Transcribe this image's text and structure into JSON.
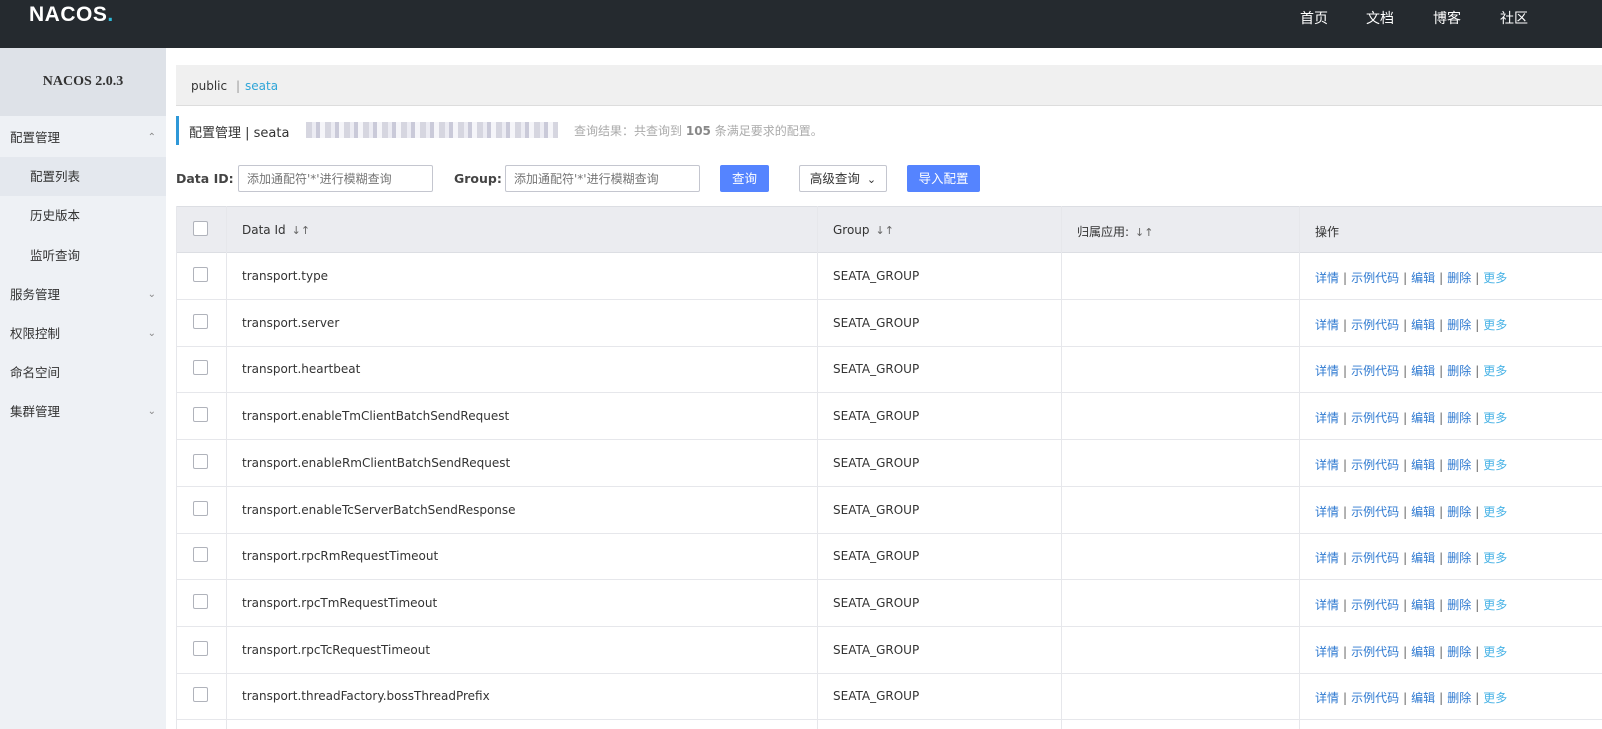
{
  "topbar": {
    "logo_text": "NACOS",
    "nav": [
      "首页",
      "文档",
      "博客",
      "社区"
    ]
  },
  "sidebar": {
    "title": "NACOS 2.0.3",
    "items": [
      {
        "label": "配置管理",
        "chevron": "up"
      },
      {
        "label": "配置列表",
        "sub": true,
        "active": true
      },
      {
        "label": "历史版本",
        "sub": true
      },
      {
        "label": "监听查询",
        "sub": true
      },
      {
        "label": "服务管理",
        "chevron": "down"
      },
      {
        "label": "权限控制",
        "chevron": "down"
      },
      {
        "label": "命名空间"
      },
      {
        "label": "集群管理",
        "chevron": "down"
      }
    ]
  },
  "namespaces": {
    "public": "public",
    "separator": "|",
    "seata": "seata"
  },
  "page": {
    "title": "配置管理 | seata",
    "query_prefix": "查询结果：共查询到",
    "query_count": "105",
    "query_suffix": "条满足要求的配置。"
  },
  "filters": {
    "dataid_label": "Data ID:",
    "dataid_placeholder": "添加通配符'*'进行模糊查询",
    "group_label": "Group:",
    "group_placeholder": "添加通配符'*'进行模糊查询",
    "query_button": "查询",
    "advanced_button": "高级查询",
    "import_button": "导入配置"
  },
  "table": {
    "headers": {
      "dataid": "Data Id",
      "group": "Group",
      "app": "归属应用:",
      "ops": "操作"
    },
    "ops": {
      "detail": "详情",
      "sample": "示例代码",
      "edit": "编辑",
      "delete": "删除",
      "more": "更多",
      "sep": "|"
    },
    "rows": [
      {
        "dataid": "transport.type",
        "group": "SEATA_GROUP",
        "app": ""
      },
      {
        "dataid": "transport.server",
        "group": "SEATA_GROUP",
        "app": ""
      },
      {
        "dataid": "transport.heartbeat",
        "group": "SEATA_GROUP",
        "app": ""
      },
      {
        "dataid": "transport.enableTmClientBatchSendRequest",
        "group": "SEATA_GROUP",
        "app": ""
      },
      {
        "dataid": "transport.enableRmClientBatchSendRequest",
        "group": "SEATA_GROUP",
        "app": ""
      },
      {
        "dataid": "transport.enableTcServerBatchSendResponse",
        "group": "SEATA_GROUP",
        "app": ""
      },
      {
        "dataid": "transport.rpcRmRequestTimeout",
        "group": "SEATA_GROUP",
        "app": ""
      },
      {
        "dataid": "transport.rpcTmRequestTimeout",
        "group": "SEATA_GROUP",
        "app": ""
      },
      {
        "dataid": "transport.rpcTcRequestTimeout",
        "group": "SEATA_GROUP",
        "app": ""
      },
      {
        "dataid": "transport.threadFactory.bossThreadPrefix",
        "group": "SEATA_GROUP",
        "app": ""
      }
    ]
  }
}
